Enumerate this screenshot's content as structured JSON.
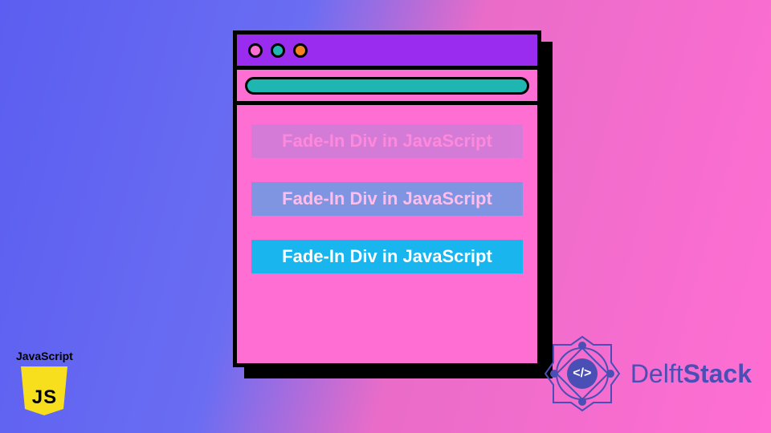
{
  "window": {
    "rows": [
      "Fade-In Div in JavaScript",
      "Fade-In Div in JavaScript",
      "Fade-In Div in JavaScript"
    ]
  },
  "js_badge": {
    "label": "JavaScript",
    "letters": "JS"
  },
  "delftstack": {
    "part1": "Delft",
    "part2": "Stack",
    "code_glyph": "</>"
  },
  "colors": {
    "purple": "#9a2cf0",
    "pink": "#ff6ed3",
    "teal": "#1fb5b0",
    "orange": "#f5821f",
    "blue": "#19b5ef",
    "delft": "#4a4fb5",
    "js_yellow": "#f7df1e"
  }
}
